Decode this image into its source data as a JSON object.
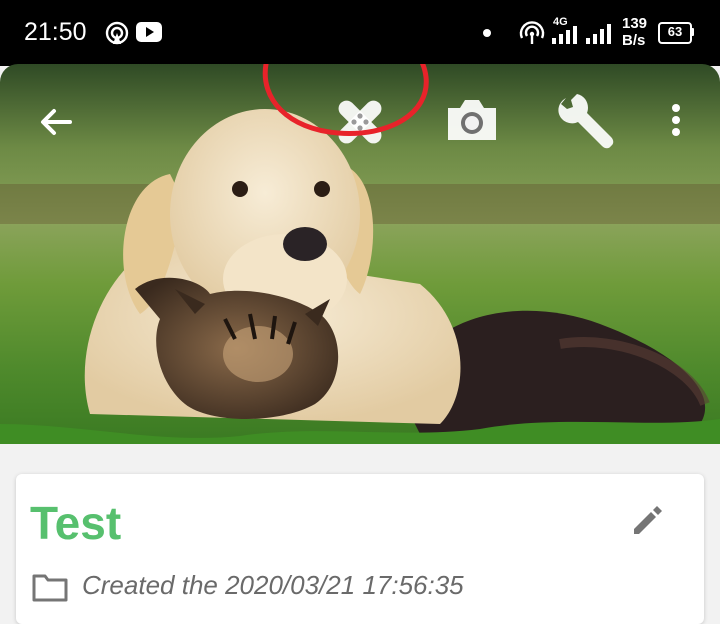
{
  "status_bar": {
    "time": "21:50",
    "network_type": "4G",
    "speed_value": "139",
    "speed_unit": "B/s",
    "battery": "63",
    "icons": [
      "hotspot-icon",
      "youtube-icon",
      "notification-dot-icon",
      "wifi-hotspot-icon",
      "signal-icon",
      "signal-icon-2",
      "battery-icon"
    ]
  },
  "toolbar": {
    "icons": [
      "back-arrow-icon",
      "bandage-icon",
      "camera-icon",
      "wrench-icon",
      "more-vert-icon"
    ],
    "annotation_color": "#e8232a"
  },
  "card": {
    "title": "Test",
    "created": "Created the 2020/03/21 17:56:35",
    "title_color": "#57c06e"
  }
}
